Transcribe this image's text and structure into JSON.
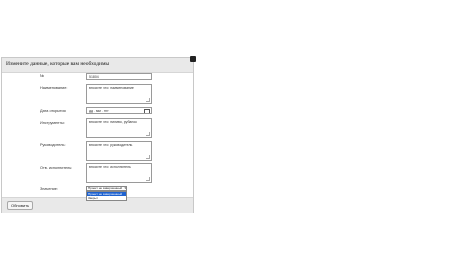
{
  "dialog": {
    "title": "Измените данные, которые вам необходимы",
    "fields": {
      "id_label": "№",
      "id_value": "51804",
      "name_label": "Наименование:",
      "name_value": "вносите что: наименование",
      "date_label": "Дата открытия",
      "date_value": "дд . мм . гггг",
      "tools_label": "Инструменты:",
      "tools_value": "вносите что: пиливо, рубанок",
      "head_label": "Руководитель:",
      "head_value": "вносите что: руководитель",
      "resp_label": "Отв. исполнитель:",
      "resp_value": "вносите что: исполнитель",
      "status_label": "Значение:",
      "status_selected": "Проект не завершенный",
      "status_options": [
        "Проект не завершенный",
        "Закрыт"
      ]
    },
    "save_label": "Обновить"
  }
}
